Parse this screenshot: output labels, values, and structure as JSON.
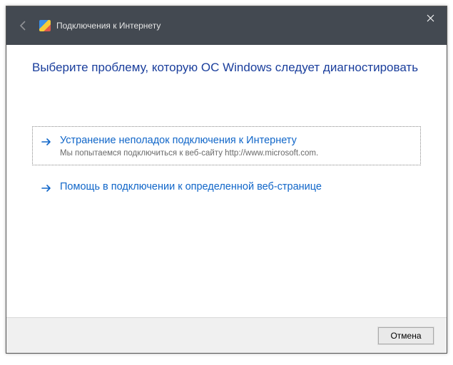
{
  "titlebar": {
    "title": "Подключения к Интернету"
  },
  "main": {
    "heading": "Выберите проблему, которую ОС Windows следует диагностировать"
  },
  "options": {
    "0": {
      "title": "Устранение неполадок подключения к Интернету",
      "subtitle": "Мы попытаемся подключиться к веб-сайту http://www.microsoft.com."
    },
    "1": {
      "title": "Помощь в подключении к определенной веб-странице"
    }
  },
  "footer": {
    "cancel": "Отмена"
  },
  "colors": {
    "link": "#1066c9",
    "heading": "#1a3e9c",
    "titlebar": "#434951"
  }
}
